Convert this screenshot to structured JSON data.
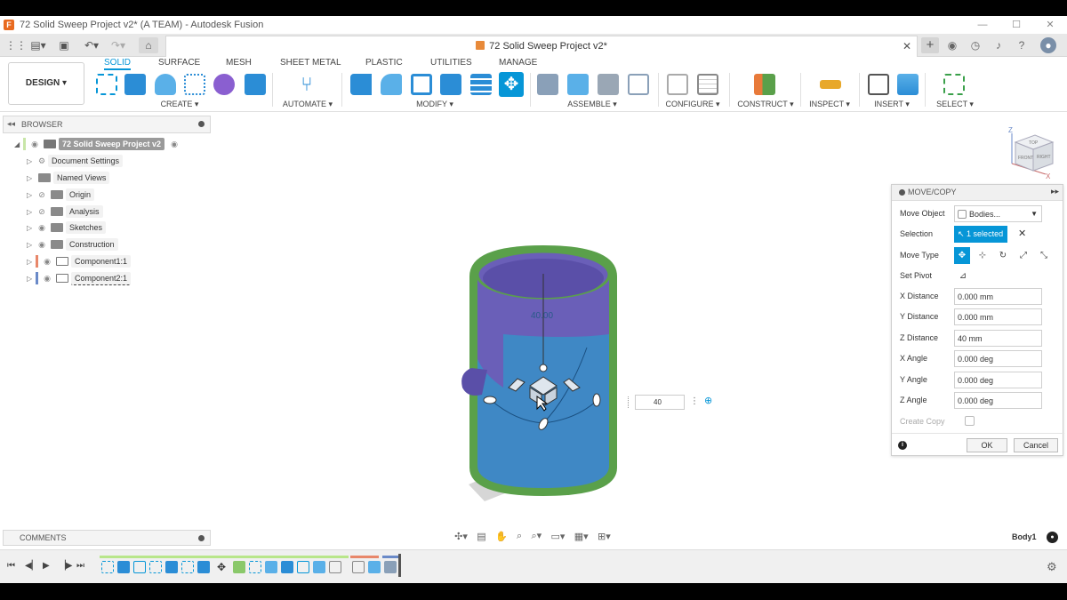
{
  "window": {
    "title": "72 Solid Sweep Project v2* (A TEAM) - Autodesk Fusion",
    "minimize": "—",
    "maximize": "☐",
    "close": "✕"
  },
  "appbar": {
    "doc_title": "72 Solid Sweep Project v2*",
    "close_tab": "✕",
    "new_tab": "+"
  },
  "toolbar": {
    "workspace": "DESIGN ▾",
    "tabs": [
      "SOLID",
      "SURFACE",
      "MESH",
      "SHEET METAL",
      "PLASTIC",
      "UTILITIES",
      "MANAGE"
    ],
    "groups": [
      "CREATE ▾",
      "AUTOMATE ▾",
      "MODIFY ▾",
      "ASSEMBLE ▾",
      "CONFIGURE ▾",
      "CONSTRUCT ▾",
      "INSPECT ▾",
      "INSERT ▾",
      "SELECT ▾"
    ]
  },
  "browser": {
    "title": "BROWSER",
    "items": [
      {
        "label": "72 Solid Sweep Project v2"
      },
      {
        "label": "Document Settings"
      },
      {
        "label": "Named Views"
      },
      {
        "label": "Origin"
      },
      {
        "label": "Analysis"
      },
      {
        "label": "Sketches"
      },
      {
        "label": "Construction"
      },
      {
        "label": "Component1:1"
      },
      {
        "label": "Component2:1"
      }
    ]
  },
  "comments": {
    "title": "COMMENTS"
  },
  "viewport": {
    "dimension_label": "40.00",
    "distance_input": "40",
    "body_name": "Body1",
    "viewcube": {
      "top": "TOP",
      "front": "FRONT",
      "right": "RIGHT"
    }
  },
  "move_copy": {
    "title": "MOVE/COPY",
    "rows": {
      "move_object": {
        "label": "Move Object",
        "value": "Bodies..."
      },
      "selection": {
        "label": "Selection",
        "value": "1 selected"
      },
      "move_type": {
        "label": "Move Type"
      },
      "set_pivot": {
        "label": "Set Pivot"
      },
      "x_distance": {
        "label": "X Distance",
        "value": "0.000 mm"
      },
      "y_distance": {
        "label": "Y Distance",
        "value": "0.000 mm"
      },
      "z_distance": {
        "label": "Z Distance",
        "value": "40 mm"
      },
      "x_angle": {
        "label": "X Angle",
        "value": "0.000 deg"
      },
      "y_angle": {
        "label": "Y Angle",
        "value": "0.000 deg"
      },
      "z_angle": {
        "label": "Z Angle",
        "value": "0.000 deg"
      },
      "create_copy": {
        "label": "Create Copy"
      }
    },
    "ok": "OK",
    "cancel": "Cancel"
  },
  "colors": {
    "accent": "#0696d7",
    "cylinder_outer": "#5aa04a",
    "cylinder_body": "#3f88c5",
    "cylinder_inner": "#6a5fb8"
  }
}
